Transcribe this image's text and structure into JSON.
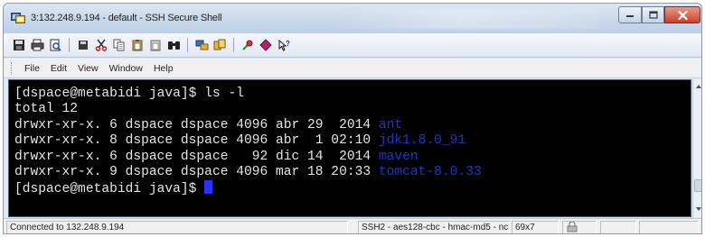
{
  "window": {
    "title": "3:132.248.9.194 - default - SSH Secure Shell",
    "controls": [
      "minimize",
      "maximize",
      "close"
    ]
  },
  "toolbar": {
    "buttons": [
      {
        "name": "save-icon"
      },
      {
        "name": "print-icon"
      },
      {
        "name": "print-preview-icon"
      },
      {
        "name": "separator"
      },
      {
        "name": "disk-icon"
      },
      {
        "name": "cut-icon"
      },
      {
        "name": "copy-icon"
      },
      {
        "name": "paste-icon"
      },
      {
        "name": "paste-special-icon"
      },
      {
        "name": "find-icon"
      },
      {
        "name": "separator"
      },
      {
        "name": "quick-connect-icon"
      },
      {
        "name": "profiles-icon"
      },
      {
        "name": "separator"
      },
      {
        "name": "settings-icon"
      },
      {
        "name": "keygen-icon"
      },
      {
        "name": "help-icon"
      }
    ]
  },
  "menu": {
    "items": [
      "File",
      "Edit",
      "View",
      "Window",
      "Help"
    ]
  },
  "terminal": {
    "prompt_line": "[dspace@metabidi java]$ ls -l",
    "total_line": "total 12",
    "entries": [
      {
        "meta": "drwxr-xr-x. 6 dspace dspace 4096 abr 29  2014 ",
        "name": "ant"
      },
      {
        "meta": "drwxr-xr-x. 8 dspace dspace 4096 abr  1 02:10 ",
        "name": "jdk1.8.0_91"
      },
      {
        "meta": "drwxr-xr-x. 6 dspace dspace   92 dic 14  2014 ",
        "name": "maven"
      },
      {
        "meta": "drwxr-xr-x. 9 dspace dspace 4096 mar 18 20:33 ",
        "name": "tomcat-8.0.33"
      }
    ],
    "current_prompt": "[dspace@metabidi java]$ "
  },
  "status": {
    "connection": "Connected to 132.248.9.194",
    "cipher": "SSH2 - aes128-cbc - hmac-md5 - nc",
    "size": "69x7"
  },
  "colors": {
    "terminal_bg": "#000000",
    "terminal_fg": "#e6e6e6",
    "directory": "#1e36c8",
    "cursor": "#2b32f4"
  }
}
